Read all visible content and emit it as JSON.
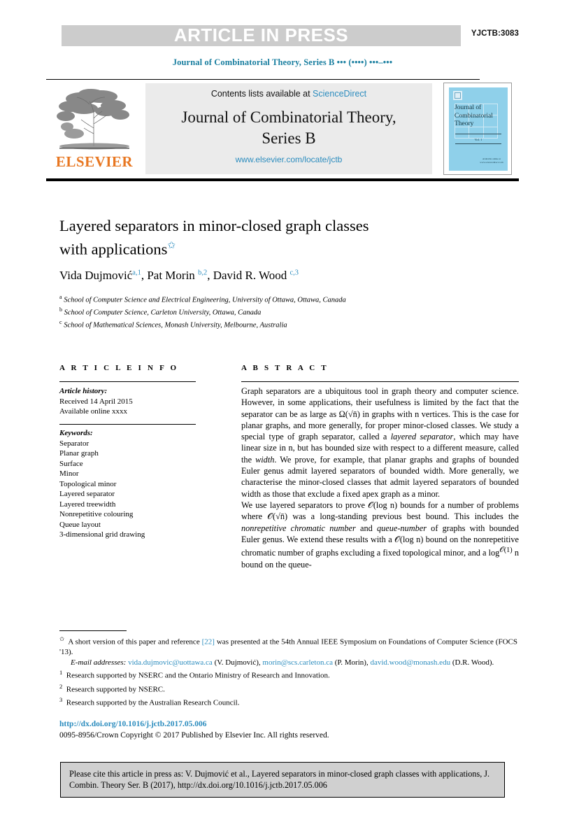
{
  "banner": {
    "article_in_press": "ARTICLE IN PRESS",
    "manuscript_code": "YJCTB:3083"
  },
  "running_head": "Journal of Combinatorial Theory, Series B ••• (••••) •••–•••",
  "masthead": {
    "contents_prefix": "Contents lists available at ",
    "sciencedirect": "ScienceDirect",
    "journal_title_line1": "Journal of Combinatorial Theory,",
    "journal_title_line2": "Series B",
    "journal_url": "www.elsevier.com/locate/jctb",
    "publisher_wordmark": "ELSEVIER",
    "cover": {
      "title": "Journal of Combinatorial Theory",
      "volume_label": "Vol. 1",
      "footer_text": "Available online at www.sciencedirect.com"
    }
  },
  "article": {
    "title": "Layered separators in minor-closed graph classes with applications",
    "title_line1": "Layered separators in minor-closed graph classes",
    "title_line2": "with applications",
    "title_footnote_symbol": "✩",
    "authors_html": "Vida Dujmović<sup>a,1</sup>, Pat Morin <sup>b,2</sup>, David R. Wood <sup>c,3</sup>",
    "affiliations": [
      {
        "marker": "a",
        "text": "School of Computer Science and Electrical Engineering, University of Ottawa, Ottawa, Canada"
      },
      {
        "marker": "b",
        "text": "School of Computer Science, Carleton University, Ottawa, Canada"
      },
      {
        "marker": "c",
        "text": "School of Mathematical Sciences, Monash University, Melbourne, Australia"
      }
    ]
  },
  "article_info": {
    "heading": "A R T I C L E   I N F O",
    "history_label": "Article history:",
    "history": [
      "Received 14 April 2015",
      "Available online xxxx"
    ],
    "keywords_label": "Keywords:",
    "keywords": [
      "Separator",
      "Planar graph",
      "Surface",
      "Minor",
      "Topological minor",
      "Layered separator",
      "Layered treewidth",
      "Nonrepetitive colouring",
      "Queue layout",
      "3-dimensional grid drawing"
    ]
  },
  "abstract": {
    "heading": "A B S T R A C T",
    "paragraph1_html": "Graph separators are a ubiquitous tool in graph theory and computer science. However, in some applications, their usefulness is limited by the fact that the separator can be as large as Ω(√n̄) in graphs with n vertices. This is the case for planar graphs, and more generally, for proper minor-closed classes. We study a special type of graph separator, called a <i>layered separator</i>, which may have linear size in n, but has bounded size with respect to a different measure, called the <i>width</i>. We prove, for example, that planar graphs and graphs of bounded Euler genus admit layered separators of bounded width. More generally, we characterise the minor-closed classes that admit layered separators of bounded width as those that exclude a fixed apex graph as a minor.",
    "paragraph2_html": "We use layered separators to prove 𝒪(log n) bounds for a number of problems where 𝒪(√n̄) was a long-standing previous best bound. This includes the <i>nonrepetitive chromatic number</i> and <i>queue-number</i> of graphs with bounded Euler genus. We extend these results with a 𝒪(log n) bound on the nonrepetitive chromatic number of graphs excluding a fixed topological minor, and a log<sup>𝒪(1)</sup> n bound on the queue-"
  },
  "footnotes": {
    "star_html": "<sup>✩</sup>&nbsp; A short version of this paper and reference <span class=\"blue\">[22]</span> was presented at the 54th Annual IEEE Symposium on Foundations of Computer Science (FOCS '13).",
    "emails_label": "E-mail addresses:",
    "emails_html": "<i>E-mail addresses:</i> <span class=\"blue\">vida.dujmovic@uottawa.ca</span> (V. Dujmović), <span class=\"blue\">morin@scs.carleton.ca</span> (P. Morin), <span class=\"blue\">david.wood@monash.edu</span> (D.R. Wood).",
    "numbered": [
      {
        "marker": "1",
        "text": "Research supported by NSERC and the Ontario Ministry of Research and Innovation."
      },
      {
        "marker": "2",
        "text": "Research supported by NSERC."
      },
      {
        "marker": "3",
        "text": "Research supported by the Australian Research Council."
      }
    ]
  },
  "publication": {
    "doi_url": "http://dx.doi.org/10.1016/j.jctb.2017.05.006",
    "copyright": "0095-8956/Crown Copyright © 2017 Published by Elsevier Inc. All rights reserved."
  },
  "cite_box": {
    "text": "Please cite this article in press as: V. Dujmović et al., Layered separators in minor-closed graph classes with applications, J. Combin. Theory Ser. B (2017), http://dx.doi.org/10.1016/j.jctb.2017.05.006"
  },
  "colors": {
    "banner_gray": "#cccccc",
    "link_blue": "#2b8cbe",
    "runhead_teal": "#1a7fa0",
    "elsevier_orange": "#e87722",
    "cover_blue": "#8fd0ea",
    "cite_box_gray": "#d0d0d0"
  }
}
